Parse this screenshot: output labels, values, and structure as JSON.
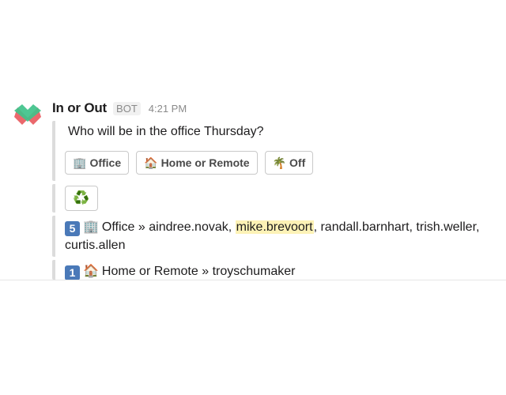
{
  "message": {
    "bot_name": "In or Out",
    "bot_badge": "BOT",
    "timestamp": "4:21 PM",
    "question": "Who will be in the office Thursday?",
    "buttons": [
      {
        "icon": "🏢",
        "icon_name": "office-building-icon",
        "label": "Office"
      },
      {
        "icon": "🏠",
        "icon_name": "house-icon",
        "label": "Home or Remote"
      },
      {
        "icon": "🌴",
        "icon_name": "palm-tree-icon",
        "label": "Off"
      }
    ],
    "refresh_button": {
      "icon": "♻️",
      "icon_name": "recycle-icon"
    },
    "summaries": [
      {
        "count": "5",
        "icon": "🏢",
        "icon_name": "office-building-icon",
        "status": "Office",
        "separator": "»",
        "people_before": "aindree.novak,",
        "highlighted_person": "mike.brevoort",
        "people_after": ", randall.barnhart, trish.weller, curtis.allen"
      },
      {
        "count": "1",
        "icon": "🏠",
        "icon_name": "house-icon",
        "status": "Home or Remote",
        "separator": "»",
        "people": "troyschumaker"
      }
    ]
  },
  "colors": {
    "accent_keycap": "#4a79b8",
    "highlight": "#fdf2b6",
    "avatar_green": "#3fc28a",
    "avatar_red": "#e8585c"
  }
}
